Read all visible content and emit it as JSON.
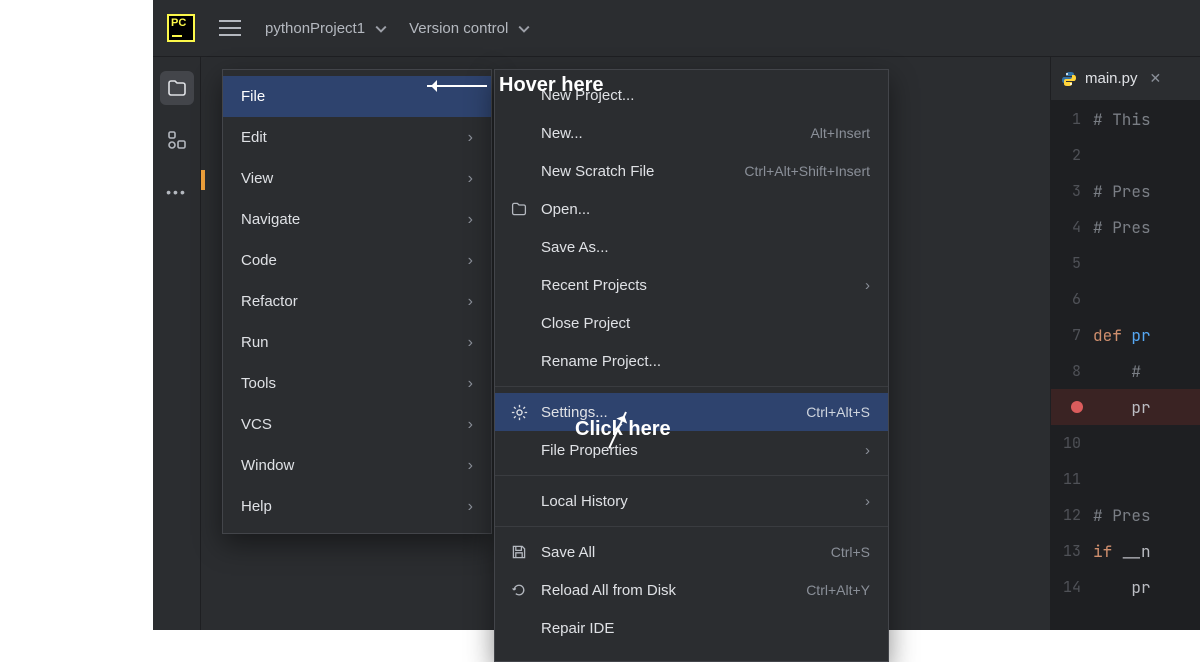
{
  "titlebar": {
    "project_name": "pythonProject1",
    "vcs_label": "Version control"
  },
  "main_menu": {
    "items": [
      {
        "label": "File",
        "has_sub": false,
        "selected": true
      },
      {
        "label": "Edit",
        "has_sub": true
      },
      {
        "label": "View",
        "has_sub": true
      },
      {
        "label": "Navigate",
        "has_sub": true
      },
      {
        "label": "Code",
        "has_sub": true
      },
      {
        "label": "Refactor",
        "has_sub": true
      },
      {
        "label": "Run",
        "has_sub": true
      },
      {
        "label": "Tools",
        "has_sub": true
      },
      {
        "label": "VCS",
        "has_sub": true
      },
      {
        "label": "Window",
        "has_sub": true
      },
      {
        "label": "Help",
        "has_sub": true
      }
    ]
  },
  "file_submenu": {
    "items": [
      {
        "label": "New Project...",
        "shortcut": "",
        "icon": "",
        "type": "item"
      },
      {
        "label": "New...",
        "shortcut": "Alt+Insert",
        "icon": "",
        "type": "item"
      },
      {
        "label": "New Scratch File",
        "shortcut": "Ctrl+Alt+Shift+Insert",
        "icon": "",
        "type": "item"
      },
      {
        "label": "Open...",
        "shortcut": "",
        "icon": "folder",
        "type": "item"
      },
      {
        "label": "Save As...",
        "shortcut": "",
        "icon": "",
        "type": "item"
      },
      {
        "label": "Recent Projects",
        "shortcut": "",
        "icon": "",
        "type": "sub"
      },
      {
        "label": "Close Project",
        "shortcut": "",
        "icon": "",
        "type": "item"
      },
      {
        "label": "Rename Project...",
        "shortcut": "",
        "icon": "",
        "type": "item"
      },
      {
        "type": "sep"
      },
      {
        "label": "Settings...",
        "shortcut": "Ctrl+Alt+S",
        "icon": "gear",
        "type": "item",
        "selected": true
      },
      {
        "label": "File Properties",
        "shortcut": "",
        "icon": "",
        "type": "sub"
      },
      {
        "type": "sep"
      },
      {
        "label": "Local History",
        "shortcut": "",
        "icon": "",
        "type": "sub"
      },
      {
        "type": "sep"
      },
      {
        "label": "Save All",
        "shortcut": "Ctrl+S",
        "icon": "save",
        "type": "item"
      },
      {
        "label": "Reload All from Disk",
        "shortcut": "Ctrl+Alt+Y",
        "icon": "reload",
        "type": "item"
      },
      {
        "label": "Repair IDE",
        "shortcut": "",
        "icon": "",
        "type": "item"
      }
    ]
  },
  "editor": {
    "tab_name": "main.py",
    "lines": [
      {
        "n": "1",
        "code": "# This",
        "cls": "tok-cmt"
      },
      {
        "n": "2",
        "code": "",
        "cls": ""
      },
      {
        "n": "3",
        "code": "# Pres",
        "cls": "tok-cmt"
      },
      {
        "n": "4",
        "code": "# Pres",
        "cls": "tok-cmt"
      },
      {
        "n": "5",
        "code": "",
        "cls": ""
      },
      {
        "n": "6",
        "code": "",
        "cls": ""
      },
      {
        "n": "7",
        "code": "def pr",
        "cls": "",
        "tokens": [
          [
            "def ",
            "tok-kw"
          ],
          [
            "pr",
            "tok-fn"
          ]
        ]
      },
      {
        "n": "8",
        "code": "    # ",
        "cls": "tok-cmt"
      },
      {
        "n": "",
        "code": "    pr",
        "cls": "",
        "bp": true
      },
      {
        "n": "10",
        "code": "",
        "cls": ""
      },
      {
        "n": "11",
        "code": "",
        "cls": ""
      },
      {
        "n": "12",
        "code": "# Pres",
        "cls": "tok-cmt"
      },
      {
        "n": "13",
        "code": "if __n",
        "cls": "",
        "tokens": [
          [
            "if ",
            "tok-kw"
          ],
          [
            "__n",
            ""
          ]
        ]
      },
      {
        "n": "14",
        "code": "    pr",
        "cls": ""
      }
    ]
  },
  "annotations": {
    "hover": "Hover here",
    "click": "Click here"
  }
}
